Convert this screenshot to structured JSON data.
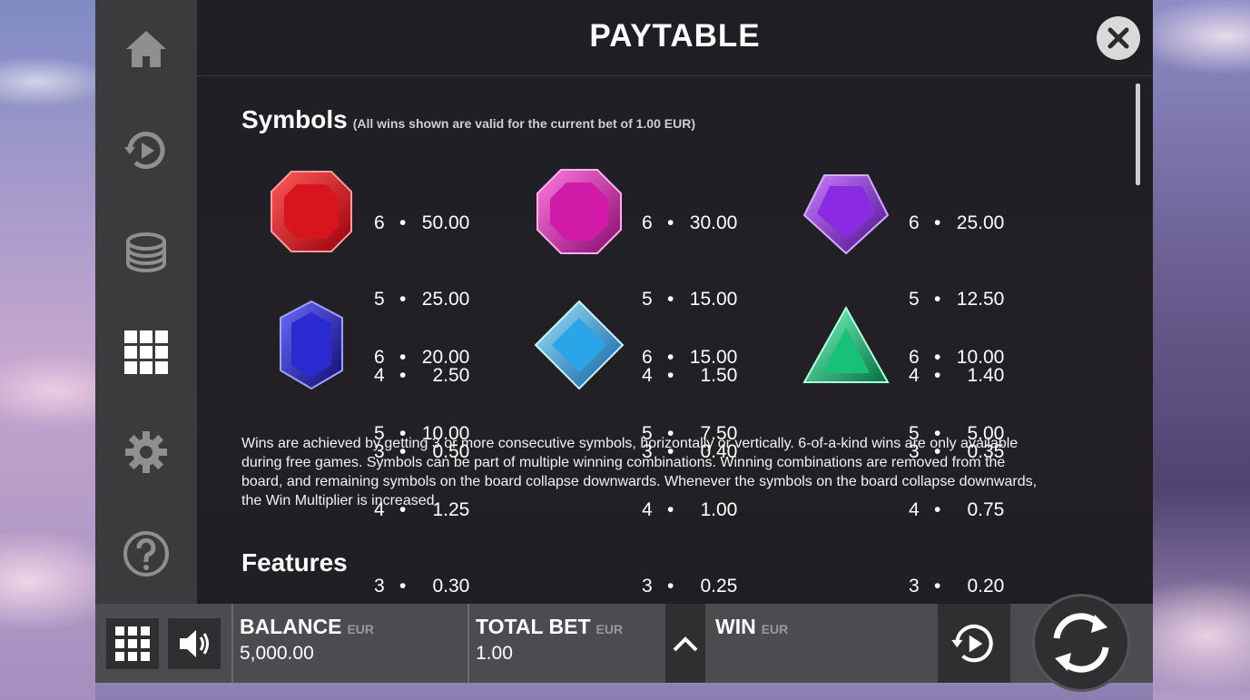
{
  "header": {
    "title": "PAYTABLE"
  },
  "sidebar": {
    "items": [
      {
        "icon": "home-icon"
      },
      {
        "icon": "autoplay-icon"
      },
      {
        "icon": "coins-icon"
      },
      {
        "icon": "paytable-grid-icon",
        "active": true
      },
      {
        "icon": "gear-icon"
      },
      {
        "icon": "help-icon"
      }
    ]
  },
  "symbols_section": {
    "title": "Symbols",
    "note": "(All wins shown are valid for the current bet of 1.00 EUR)",
    "symbols": [
      {
        "icon": "red-gem-icon",
        "color": "#e01b24",
        "pays": [
          {
            "n": "6",
            "v": "50.00"
          },
          {
            "n": "5",
            "v": "25.00"
          },
          {
            "n": "4",
            "v": "2.50"
          },
          {
            "n": "3",
            "v": "0.50"
          }
        ]
      },
      {
        "icon": "pink-gem-icon",
        "color": "#d21aa8",
        "pays": [
          {
            "n": "6",
            "v": "30.00"
          },
          {
            "n": "5",
            "v": "15.00"
          },
          {
            "n": "4",
            "v": "1.50"
          },
          {
            "n": "3",
            "v": "0.40"
          }
        ]
      },
      {
        "icon": "purple-gem-icon",
        "color": "#8a2be2",
        "pays": [
          {
            "n": "6",
            "v": "25.00"
          },
          {
            "n": "5",
            "v": "12.50"
          },
          {
            "n": "4",
            "v": "1.40"
          },
          {
            "n": "3",
            "v": "0.35"
          }
        ]
      },
      {
        "icon": "blue-gem-icon",
        "color": "#2a2ad0",
        "pays": [
          {
            "n": "6",
            "v": "20.00"
          },
          {
            "n": "5",
            "v": "10.00"
          },
          {
            "n": "4",
            "v": "1.25"
          },
          {
            "n": "3",
            "v": "0.30"
          }
        ]
      },
      {
        "icon": "cyan-gem-icon",
        "color": "#2aa6e8",
        "pays": [
          {
            "n": "6",
            "v": "15.00"
          },
          {
            "n": "5",
            "v": "7.50"
          },
          {
            "n": "4",
            "v": "1.00"
          },
          {
            "n": "3",
            "v": "0.25"
          }
        ]
      },
      {
        "icon": "green-gem-icon",
        "color": "#16c27a",
        "pays": [
          {
            "n": "6",
            "v": "10.00"
          },
          {
            "n": "5",
            "v": "5.00"
          },
          {
            "n": "4",
            "v": "0.75"
          },
          {
            "n": "3",
            "v": "0.20"
          }
        ]
      }
    ],
    "description": "Wins are achieved by getting 3 or more consecutive symbols, horizontally or vertically. 6-of-a-kind wins are only available during free games. Symbols can be part of multiple winning combinations. Winning combinations are removed from the board, and remaining symbols on the board collapse downwards. Whenever the symbols on the board collapse downwards, the Win Multiplier is increased."
  },
  "features_section": {
    "title": "Features"
  },
  "bottom_bar": {
    "balance_label": "BALANCE",
    "balance_unit": "EUR",
    "balance_value": "5,000.00",
    "total_bet_label": "TOTAL BET",
    "total_bet_unit": "EUR",
    "total_bet_value": "1.00",
    "win_label": "WIN",
    "win_unit": "EUR",
    "win_value": ""
  }
}
